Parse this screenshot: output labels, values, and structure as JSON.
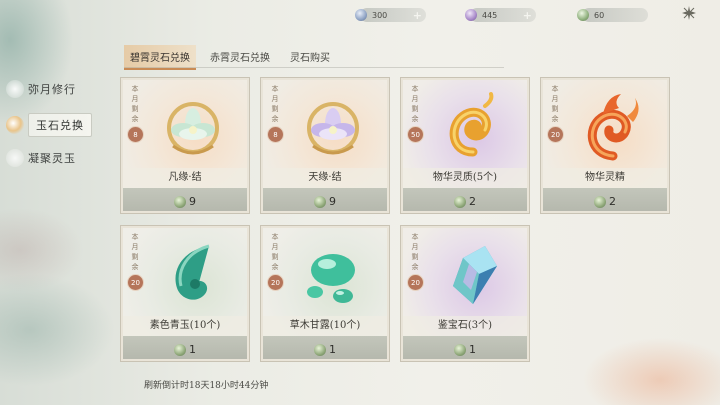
{
  "currencies": [
    {
      "value": "300",
      "color": "#8fa3c4",
      "plus": "+"
    },
    {
      "value": "445",
      "color": "#a889c9",
      "plus": "+"
    },
    {
      "value": "60",
      "color": "#8fb07d",
      "plus": ""
    }
  ],
  "tabs": [
    {
      "label": "碧霄灵石兑换"
    },
    {
      "label": "赤霄灵石兑换"
    },
    {
      "label": "灵石购买"
    }
  ],
  "sidebar": {
    "items": [
      {
        "label": "弥月修行"
      },
      {
        "label": "玉石兑换"
      },
      {
        "label": "凝聚灵玉"
      }
    ]
  },
  "monthly_label": [
    "本",
    "月",
    "剩",
    "余"
  ],
  "cards": [
    {
      "name": "凡缘·结",
      "remaining": "8",
      "price": "9",
      "bg": "orange",
      "icon": "white-lotus-charm-icon"
    },
    {
      "name": "天缘·结",
      "remaining": "8",
      "price": "9",
      "bg": "orange",
      "icon": "purple-lotus-charm-icon"
    },
    {
      "name": "物华灵质(5个)",
      "remaining": "50",
      "price": "2",
      "bg": "purple",
      "icon": "golden-swirl-icon"
    },
    {
      "name": "物华灵精",
      "remaining": "20",
      "price": "2",
      "bg": "orange",
      "icon": "flame-swirl-icon"
    },
    {
      "name": "素色青玉(10个)",
      "remaining": "20",
      "price": "1",
      "bg": "green",
      "icon": "jade-leaf-icon"
    },
    {
      "name": "草木甘露(10个)",
      "remaining": "20",
      "price": "1",
      "bg": "green",
      "icon": "dew-drops-icon"
    },
    {
      "name": "鉴宝石(3个)",
      "remaining": "20",
      "price": "1",
      "bg": "purple",
      "icon": "crystal-gem-icon"
    }
  ],
  "refresh_text": "刷新倒计时18天18小时44分钟"
}
